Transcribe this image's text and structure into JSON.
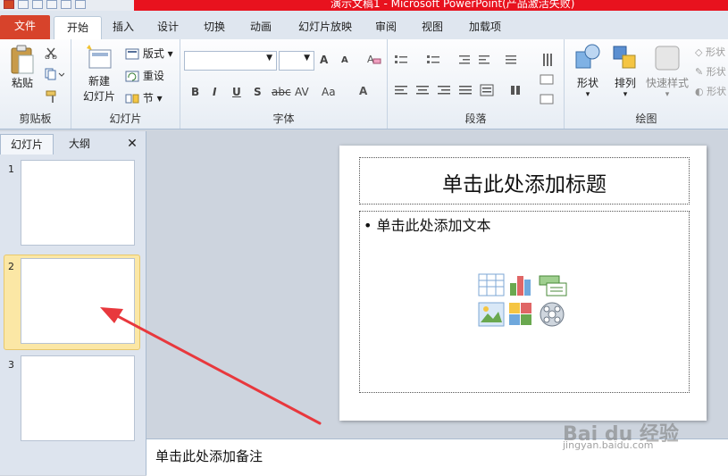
{
  "window": {
    "title": "演示文稿1 - Microsoft PowerPoint(产品激活失败)"
  },
  "tabs": [
    "文件",
    "开始",
    "插入",
    "设计",
    "切换",
    "动画",
    "幻灯片放映",
    "审阅",
    "视图",
    "加载项"
  ],
  "ribbon": {
    "clipboard": {
      "paste": "粘贴",
      "label": "剪贴板"
    },
    "slides": {
      "new_slide_line1": "新建",
      "new_slide_line2": "幻灯片",
      "layout": "版式",
      "reset": "重设",
      "section": "节",
      "label": "幻灯片"
    },
    "font": {
      "label": "字体",
      "bold": "B",
      "italic": "I",
      "underline": "U",
      "shadow": "S",
      "strike": "abc",
      "spacing": "AV",
      "case": "Aa",
      "grow": "A",
      "shrink": "A"
    },
    "paragraph": {
      "label": "段落"
    },
    "drawing": {
      "shapes": "形状",
      "arrange": "排列",
      "quick_styles": "快速样式",
      "label": "绘图",
      "fill": "形状",
      "outline": "形状",
      "effect": "形状"
    }
  },
  "left_panel": {
    "tab_slides": "幻灯片",
    "tab_outline": "大纲",
    "close": "✕",
    "thumbnails": [
      {
        "num": "1",
        "selected": false
      },
      {
        "num": "2",
        "selected": true
      },
      {
        "num": "3",
        "selected": false
      }
    ]
  },
  "slide": {
    "title_placeholder": "单击此处添加标题",
    "body_placeholder": "单击此处添加文本",
    "bullet": "•"
  },
  "notes": {
    "placeholder": "单击此处添加备注"
  },
  "watermark": {
    "text": "Bai du 经验",
    "url": "jingyan.baidu.com"
  },
  "annotation": {
    "arrow_color": "#e8383d"
  }
}
